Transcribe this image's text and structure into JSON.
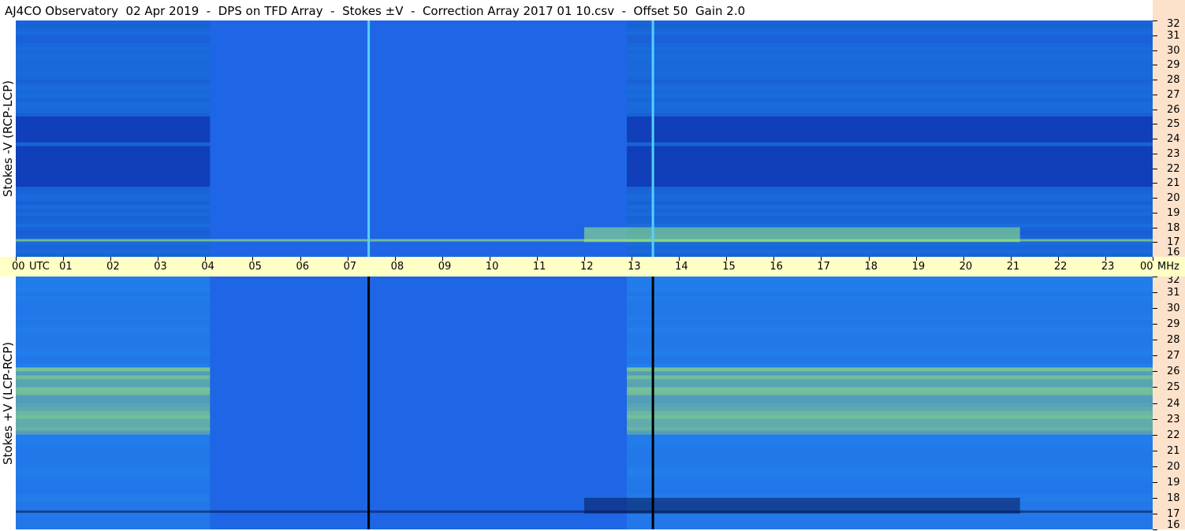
{
  "title": "AJ4CO Observatory  02 Apr 2019  -  DPS on TFD Array  -  Stokes ±V  -  Correction Array 2017 01 10.csv  -  Offset 50  Gain 2.0",
  "colors": {
    "background_blue": "#1e66e6",
    "deep_blue": "#0b2fa6",
    "cyan": "#1f9af2",
    "green_yellow": "#a8f06a",
    "time_axis_bg": "#ffffc6",
    "freq_axis_bg": "#fde2cb"
  },
  "chart_data": [
    {
      "type": "heatmap",
      "name": "Stokes -V",
      "ylabel": "Stokes -V (RCP-LCP)",
      "x_axis": "UTC hour",
      "xlim": [
        0,
        24
      ],
      "ylim": [
        16,
        32
      ],
      "y_unit": "MHz",
      "vertical_lines": [
        7.45,
        13.45
      ],
      "burst_region": {
        "x": [
          12,
          21.2
        ],
        "y": [
          17,
          18
        ]
      },
      "dark_bands_mhz": [
        21.5,
        22.5,
        24.5
      ]
    },
    {
      "type": "heatmap",
      "name": "Stokes +V",
      "ylabel": "Stokes +V (LCP-RCP)",
      "x_axis": "UTC hour",
      "xlim": [
        0,
        24
      ],
      "ylim": [
        16,
        32
      ],
      "y_unit": "MHz",
      "vertical_lines": [
        7.45,
        13.45
      ],
      "burst_region": {
        "x": [
          12,
          21.2
        ],
        "y": [
          17,
          18
        ]
      },
      "bright_bands_mhz": [
        22.5,
        23.5,
        24.5,
        25.5
      ]
    }
  ],
  "time_axis": {
    "ticks": [
      "00",
      "01",
      "02",
      "03",
      "04",
      "05",
      "06",
      "07",
      "08",
      "09",
      "10",
      "11",
      "12",
      "13",
      "14",
      "15",
      "16",
      "17",
      "18",
      "19",
      "20",
      "21",
      "22",
      "23",
      "00"
    ],
    "utc_label": "UTC",
    "mhz_label": "MHz"
  },
  "freq_axis": {
    "ticks": [
      "32",
      "31",
      "30",
      "29",
      "28",
      "27",
      "26",
      "25",
      "24",
      "23",
      "22",
      "21",
      "20",
      "19",
      "18",
      "17",
      "16"
    ]
  }
}
